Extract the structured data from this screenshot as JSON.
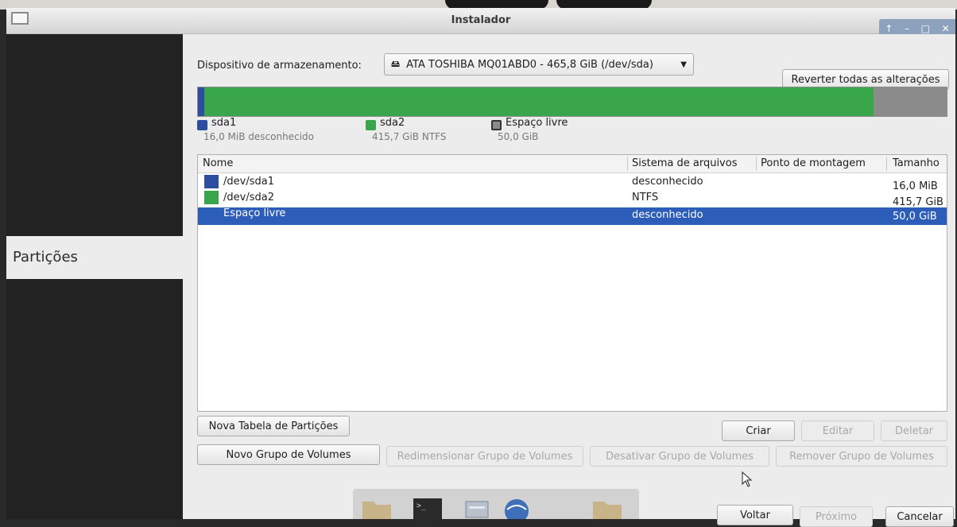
{
  "window": {
    "title": "Instalador"
  },
  "sidebar": {
    "active_item": "Partições"
  },
  "device": {
    "label": "Dispositivo de armazenamento:",
    "selected": "ATA TOSHIBA MQ01ABD0 - 465,8 GiB (/dev/sda)"
  },
  "buttons": {
    "revert": "Reverter todas as alterações",
    "new_table": "Nova Tabela de Partições",
    "create": "Criar",
    "edit": "Editar",
    "delete": "Deletar",
    "new_vg": "Novo Grupo de Volumes",
    "resize_vg": "Redimensionar Grupo de Volumes",
    "deactivate_vg": "Desativar Grupo de Volumes",
    "remove_vg": "Remover Grupo de Volumes",
    "back": "Voltar",
    "next": "Próximo",
    "cancel": "Cancelar"
  },
  "legend": [
    {
      "name": "sda1",
      "size": "16,0 MiB",
      "fs": "desconhecido",
      "color": "#2c4da0"
    },
    {
      "name": "sda2",
      "size": "415,7 GiB",
      "fs": "NTFS",
      "color": "#3aa64b"
    },
    {
      "name": "Espaço livre",
      "size": "50,0 GiB",
      "color": "#8b8b8b"
    }
  ],
  "table": {
    "columns": [
      "Nome",
      "Sistema de arquivos",
      "Ponto de montagem",
      "Tamanho"
    ],
    "rows": [
      {
        "name": "/dev/sda1",
        "fs": "desconhecido",
        "mount": "",
        "size": "16,0 MiB",
        "color": "#2c4da0",
        "selected": false
      },
      {
        "name": "/dev/sda2",
        "fs": "NTFS",
        "mount": "",
        "size": "415,7 GiB",
        "color": "#3aa64b",
        "selected": false
      },
      {
        "name": "Espaço livre",
        "fs": "desconhecido",
        "mount": "",
        "size": "50,0 GiB",
        "color": "#2c5db8",
        "selected": true
      }
    ]
  },
  "colors": {
    "selection": "#2c5db8",
    "sda1": "#2c4da0",
    "sda2": "#3aa64b",
    "free": "#8b8b8b"
  },
  "disk_usage": {
    "sda1_fraction": 3.36e-05,
    "sda2_fraction": 0.8926,
    "free_fraction": 0.1074
  },
  "taskbar": {
    "icons": [
      "folder-icon",
      "terminal-icon",
      "files-icon",
      "network-icon",
      "folder-icon"
    ]
  }
}
